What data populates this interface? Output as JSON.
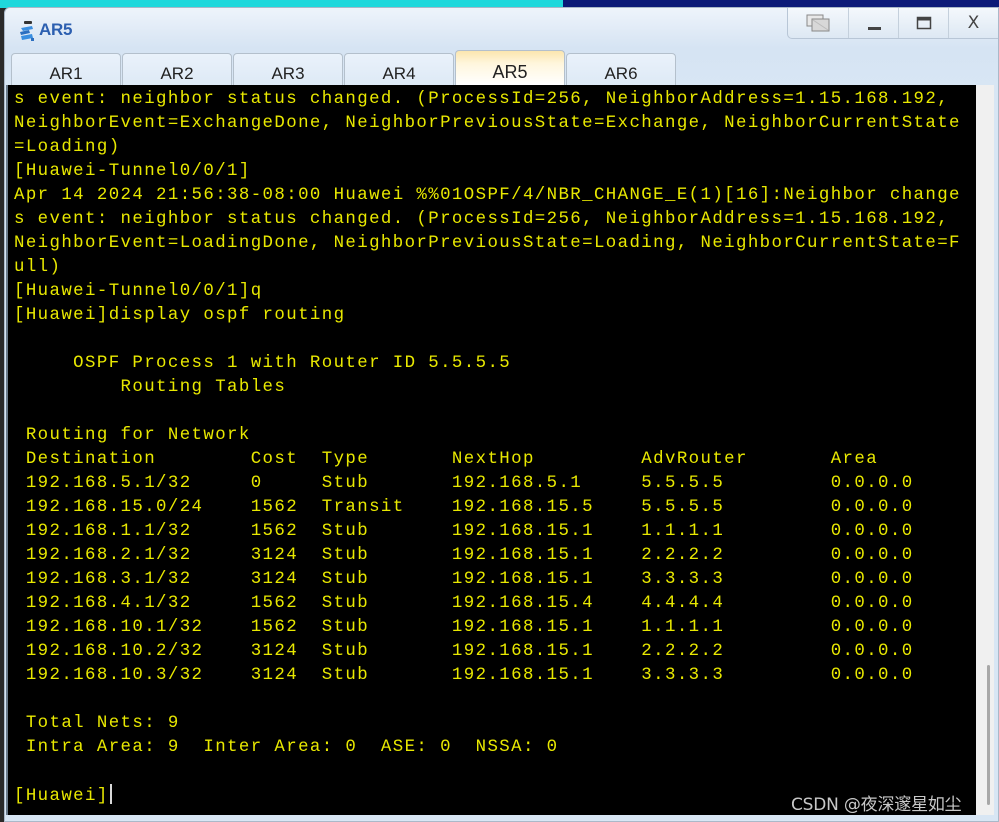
{
  "window": {
    "title": "AR5",
    "controls": {
      "restore": "restore",
      "minimize": "minimize",
      "maximize": "maximize",
      "close": "X"
    }
  },
  "tabs": [
    {
      "label": "AR1",
      "active": false
    },
    {
      "label": "AR2",
      "active": false
    },
    {
      "label": "AR3",
      "active": false
    },
    {
      "label": "AR4",
      "active": false
    },
    {
      "label": "AR5",
      "active": true
    },
    {
      "label": "AR6",
      "active": false
    }
  ],
  "terminal": {
    "text_color": "#e8e800",
    "log_lines": [
      "s event: neighbor status changed. (ProcessId=256, NeighborAddress=1.15.168.192,",
      "NeighborEvent=ExchangeDone, NeighborPreviousState=Exchange, NeighborCurrentState",
      "=Loading)",
      "[Huawei-Tunnel0/0/1]",
      "Apr 14 2024 21:56:38-08:00 Huawei %%01OSPF/4/NBR_CHANGE_E(1)[16]:Neighbor change",
      "s event: neighbor status changed. (ProcessId=256, NeighborAddress=1.15.168.192,",
      "NeighborEvent=LoadingDone, NeighborPreviousState=Loading, NeighborCurrentState=F",
      "ull)",
      "[Huawei-Tunnel0/0/1]q",
      "[Huawei]display ospf routing",
      "",
      "\t OSPF Process 1 with Router ID 5.5.5.5",
      "\t\t Routing Tables",
      "",
      " Routing for Network"
    ],
    "routing_table": {
      "columns": [
        "Destination",
        "Cost",
        "Type",
        "NextHop",
        "AdvRouter",
        "Area"
      ],
      "rows": [
        [
          "192.168.5.1/32",
          "0",
          "Stub",
          "192.168.5.1",
          "5.5.5.5",
          "0.0.0.0"
        ],
        [
          "192.168.15.0/24",
          "1562",
          "Transit",
          "192.168.15.5",
          "5.5.5.5",
          "0.0.0.0"
        ],
        [
          "192.168.1.1/32",
          "1562",
          "Stub",
          "192.168.15.1",
          "1.1.1.1",
          "0.0.0.0"
        ],
        [
          "192.168.2.1/32",
          "3124",
          "Stub",
          "192.168.15.1",
          "2.2.2.2",
          "0.0.0.0"
        ],
        [
          "192.168.3.1/32",
          "3124",
          "Stub",
          "192.168.15.1",
          "3.3.3.3",
          "0.0.0.0"
        ],
        [
          "192.168.4.1/32",
          "1562",
          "Stub",
          "192.168.15.4",
          "4.4.4.4",
          "0.0.0.0"
        ],
        [
          "192.168.10.1/32",
          "1562",
          "Stub",
          "192.168.15.1",
          "1.1.1.1",
          "0.0.0.0"
        ],
        [
          "192.168.10.2/32",
          "3124",
          "Stub",
          "192.168.15.1",
          "2.2.2.2",
          "0.0.0.0"
        ],
        [
          "192.168.10.3/32",
          "3124",
          "Stub",
          "192.168.15.1",
          "3.3.3.3",
          "0.0.0.0"
        ]
      ]
    },
    "summary_lines": [
      " Total Nets: 9",
      " Intra Area: 9  Inter Area: 0  ASE: 0  NSSA: 0"
    ],
    "prompt": "[Huawei]"
  },
  "watermark": "CSDN @夜深邃星如尘"
}
